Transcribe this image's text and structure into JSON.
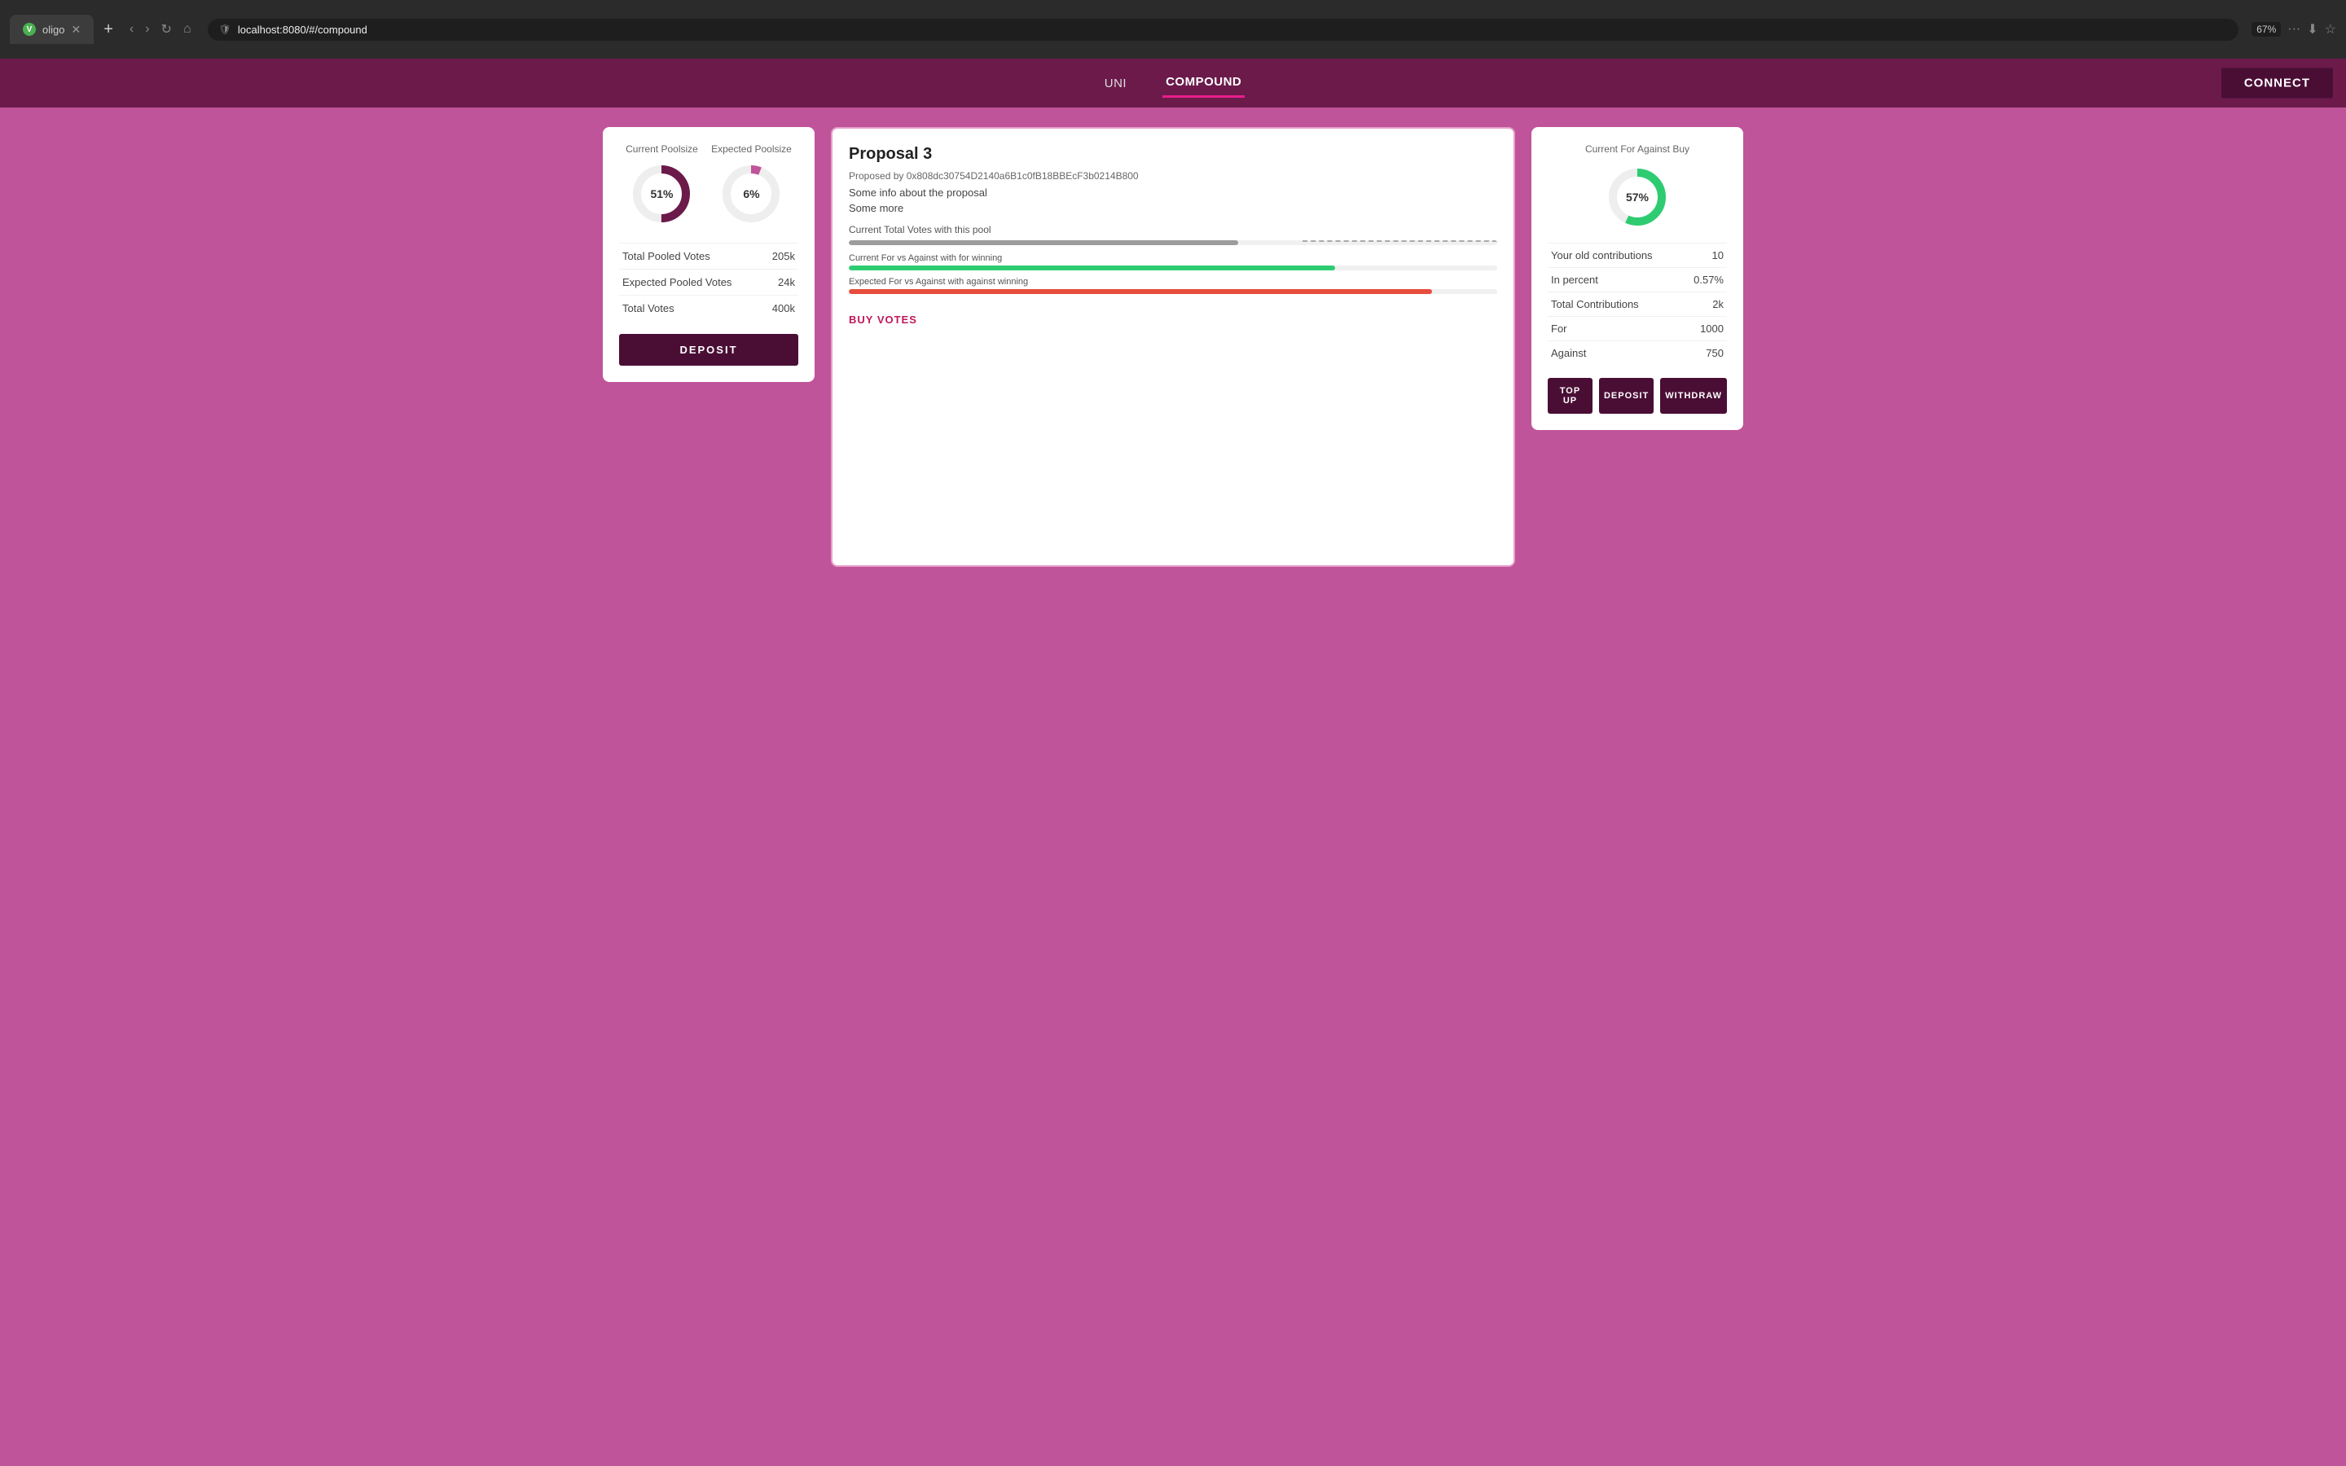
{
  "browser": {
    "tab_title": "oligo",
    "url": "localhost:8080/#/compound",
    "zoom": "67%"
  },
  "nav": {
    "links": [
      {
        "label": "UNI",
        "active": false
      },
      {
        "label": "COMPOUND",
        "active": true
      }
    ],
    "connect_label": "CONNECT"
  },
  "left_card": {
    "donut1_label": "Current Poolsize",
    "donut1_value": "51%",
    "donut1_percent": 51,
    "donut2_label": "Expected Poolsize",
    "donut2_value": "6%",
    "donut2_percent": 6,
    "stats": [
      {
        "label": "Total Pooled Votes",
        "value": "205k"
      },
      {
        "label": "Expected Pooled Votes",
        "value": "24k"
      },
      {
        "label": "Total Votes",
        "value": "400k"
      }
    ],
    "deposit_label": "DEPOSIT"
  },
  "middle_card": {
    "title": "Proposal 3",
    "address": "Proposed by 0x808dc30754D2140a6B1c0fB18BBEcF3b0214B800",
    "desc1": "Some info about the proposal",
    "desc2": "Some more",
    "votes_label": "Current Total Votes with this pool",
    "bar1_label": "Current For vs Against with for winning",
    "bar1_fill": 75,
    "bar2_label": "Expected For vs Against with against winning",
    "bar2_fill": 90,
    "buy_votes_label": "BUY VOTES"
  },
  "right_card": {
    "title": "Current For Against Buy",
    "donut_value": "57%",
    "donut_percent": 57,
    "stats": [
      {
        "label": "Your old contributions",
        "value": "10"
      },
      {
        "label": "In percent",
        "value": "0.57%"
      },
      {
        "label": "Total Contributions",
        "value": "2k"
      },
      {
        "label": "For",
        "value": "1000"
      },
      {
        "label": "Against",
        "value": "750"
      }
    ],
    "btn_topup": "TOP UP",
    "btn_deposit": "DEPOSIT",
    "btn_withdraw": "WITHDRAW"
  }
}
